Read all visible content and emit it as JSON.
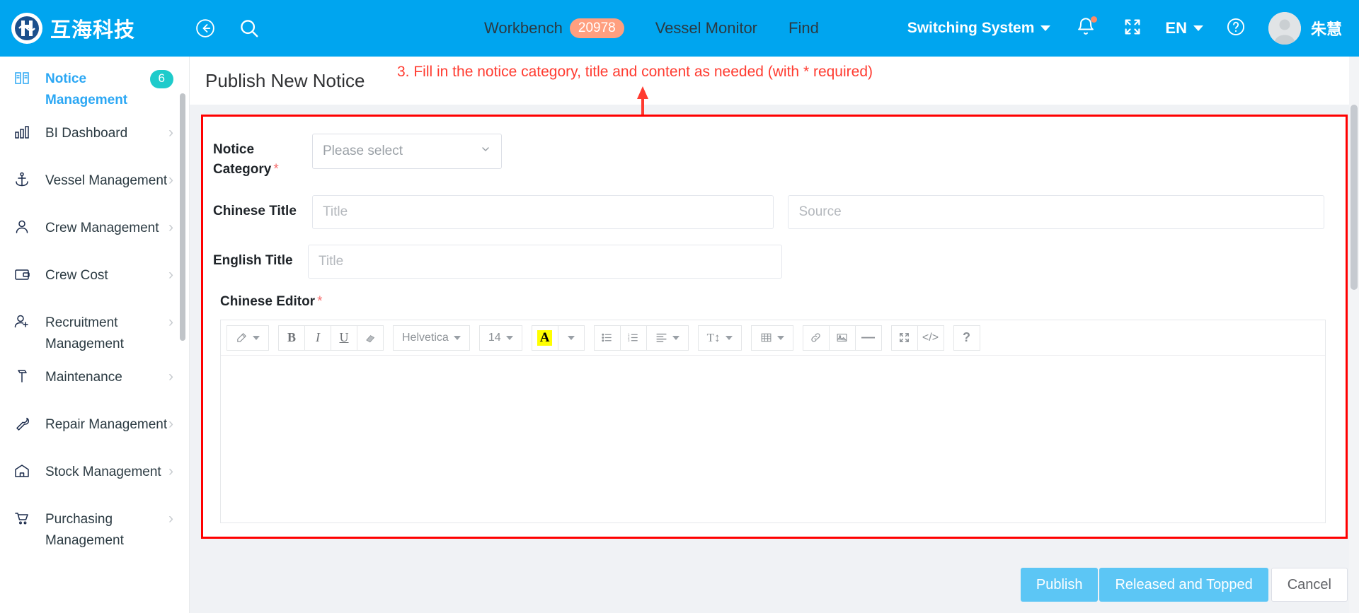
{
  "header": {
    "brand_name": "互海科技",
    "brand_logo_icon": "company-logo-icon",
    "back_icon": "back-arrow-circle-icon",
    "search_icon": "search-icon",
    "nav_items": [
      {
        "label": "Workbench",
        "badge": "20978"
      },
      {
        "label": "Vessel Monitor",
        "badge": ""
      },
      {
        "label": "Find",
        "badge": ""
      }
    ],
    "switch_system_label": "Switching System",
    "notification_icon": "bell-icon",
    "fullscreen_icon": "fullscreen-expand-icon",
    "language_label": "EN",
    "help_icon": "question-circle-icon",
    "avatar_icon": "user-avatar-icon",
    "user_name": "朱慧"
  },
  "sidebar": {
    "items": [
      {
        "label": "Notice Management",
        "icon": "book-open-icon",
        "badge": "6",
        "chevron": "",
        "active": true
      },
      {
        "label": "BI Dashboard",
        "icon": "bar-chart-icon",
        "badge": "",
        "chevron": "›",
        "active": false
      },
      {
        "label": "Vessel Management",
        "icon": "anchor-icon",
        "badge": "",
        "chevron": "›",
        "active": false
      },
      {
        "label": "Crew Management",
        "icon": "person-icon",
        "badge": "",
        "chevron": "›",
        "active": false
      },
      {
        "label": "Crew Cost",
        "icon": "wallet-icon",
        "badge": "",
        "chevron": "›",
        "active": false
      },
      {
        "label": "Recruitment Management",
        "icon": "person-add-icon",
        "badge": "",
        "chevron": "›",
        "active": false
      },
      {
        "label": "Maintenance",
        "icon": "hammer-icon",
        "badge": "",
        "chevron": "›",
        "active": false
      },
      {
        "label": "Repair Management",
        "icon": "wrench-icon",
        "badge": "",
        "chevron": "›",
        "active": false
      },
      {
        "label": "Stock Management",
        "icon": "warehouse-icon",
        "badge": "",
        "chevron": "›",
        "active": false
      },
      {
        "label": "Purchasing Management",
        "icon": "shopping-cart-icon",
        "badge": "",
        "chevron": "›",
        "active": false
      }
    ]
  },
  "main": {
    "page_title": "Publish New Notice",
    "annotation": "3. Fill in the notice category, title and content as needed (with * required)",
    "annotation_color": "#FF3B30",
    "highlight_border_color": "#FF0000",
    "form": {
      "notice_category": {
        "label": "Notice Category",
        "required": "*",
        "value": "Please select",
        "chevron_icon": "chevron-down-icon"
      },
      "chinese_title": {
        "label": "Chinese Title",
        "placeholder": "Title",
        "value": ""
      },
      "source": {
        "placeholder": "Source",
        "value": ""
      },
      "english_title": {
        "label": "English Title",
        "placeholder": "Title",
        "value": ""
      },
      "chinese_editor": {
        "label": "Chinese Editor",
        "required": "*",
        "content": ""
      }
    },
    "editor_toolbar": {
      "groups": [
        [
          {
            "name": "style-brush-button",
            "glyph": "✐",
            "icon": "magic-wand-icon",
            "caret": true,
            "label": ""
          }
        ],
        [
          {
            "name": "bold-button",
            "glyph": "B",
            "icon": "bold-icon",
            "caret": false,
            "label": ""
          },
          {
            "name": "italic-button",
            "glyph": "I",
            "icon": "italic-icon",
            "caret": false,
            "label": ""
          },
          {
            "name": "underline-button",
            "glyph": "U",
            "icon": "underline-icon",
            "caret": false,
            "label": ""
          },
          {
            "name": "clear-format-button",
            "glyph": "▰",
            "icon": "eraser-icon",
            "caret": false,
            "label": ""
          }
        ],
        [
          {
            "name": "font-family-select",
            "glyph": "",
            "icon": "font-family-icon",
            "caret": true,
            "label": "Helvetica"
          }
        ],
        [
          {
            "name": "font-size-select",
            "glyph": "",
            "icon": "font-size-icon",
            "caret": true,
            "label": "14"
          }
        ],
        [
          {
            "name": "text-highlight-button",
            "glyph": "A",
            "icon": "highlight-color-icon",
            "caret": false,
            "label": ""
          },
          {
            "name": "text-highlight-dropdown",
            "glyph": "",
            "icon": "chevron-down-icon",
            "caret": true,
            "label": ""
          }
        ],
        [
          {
            "name": "unordered-list-button",
            "glyph": "",
            "icon": "bullet-list-icon",
            "caret": false,
            "label": ""
          },
          {
            "name": "ordered-list-button",
            "glyph": "",
            "icon": "numbered-list-icon",
            "caret": false,
            "label": ""
          },
          {
            "name": "align-button",
            "glyph": "",
            "icon": "align-left-icon",
            "caret": true,
            "label": ""
          }
        ],
        [
          {
            "name": "line-height-button",
            "glyph": "T↕",
            "icon": "line-height-icon",
            "caret": true,
            "label": ""
          }
        ],
        [
          {
            "name": "table-button",
            "glyph": "",
            "icon": "table-icon",
            "caret": true,
            "label": ""
          }
        ],
        [
          {
            "name": "insert-link-button",
            "glyph": "",
            "icon": "link-icon",
            "caret": false,
            "label": ""
          },
          {
            "name": "insert-image-button",
            "glyph": "",
            "icon": "image-icon",
            "caret": false,
            "label": ""
          },
          {
            "name": "horizontal-rule-button",
            "glyph": "—",
            "icon": "horizontal-rule-icon",
            "caret": false,
            "label": ""
          }
        ],
        [
          {
            "name": "fullscreen-button",
            "glyph": "",
            "icon": "fullscreen-expand-icon",
            "caret": false,
            "label": ""
          },
          {
            "name": "source-code-button",
            "glyph": "</>",
            "icon": "code-icon",
            "caret": false,
            "label": ""
          }
        ],
        [
          {
            "name": "help-button",
            "glyph": "?",
            "icon": "question-mark-icon",
            "caret": false,
            "label": ""
          }
        ]
      ]
    },
    "footer": {
      "publish_label": "Publish",
      "released_topped_label": "Released and Topped",
      "cancel_label": "Cancel",
      "primary_color": "#5CC6F5"
    }
  }
}
